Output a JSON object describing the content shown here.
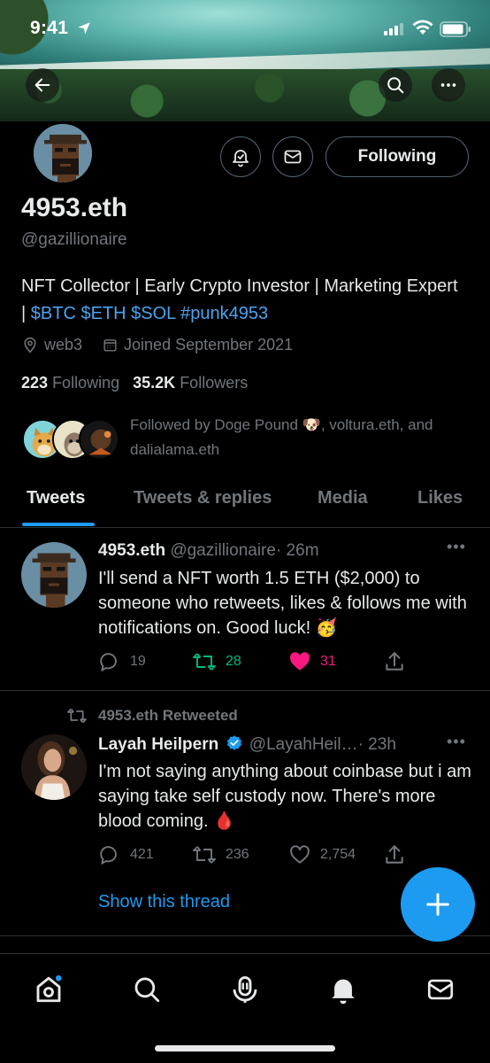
{
  "status_bar": {
    "time": "9:41"
  },
  "profile": {
    "name": "4953.eth",
    "handle": "@gazillionaire",
    "following_button": "Following",
    "bio_plain": "NFT Collector | Early Crypto Investor | Marketing Expert | ",
    "bio_links": [
      "$BTC",
      "$ETH",
      "$SOL",
      "#punk4953"
    ],
    "location": "web3",
    "joined": "Joined September 2021",
    "following_count": "223",
    "following_label": "Following",
    "followers_count": "35.2K",
    "followers_label": "Followers",
    "followed_by": "Followed by Doge Pound 🐶, voltura.eth, and dalialama.eth"
  },
  "tabs": [
    {
      "label": "Tweets",
      "active": true
    },
    {
      "label": "Tweets & replies",
      "active": false
    },
    {
      "label": "Media",
      "active": false
    },
    {
      "label": "Likes",
      "active": false
    }
  ],
  "tweets": [
    {
      "author": "4953.eth",
      "handle": "@gazillionaire",
      "time": "· 26m",
      "text": "I'll send a NFT worth 1.5 ETH ($2,000) to someone who retweets, likes & follows me with notifications on. Good luck! 🥳",
      "replies": "19",
      "retweets": "28",
      "likes": "31"
    },
    {
      "retweeted_by": "4953.eth Retweeted",
      "author": "Layah Heilpern",
      "handle": "@LayahHeil…",
      "time": "· 23h",
      "text": "I'm not saying anything about coinbase but i am saying take self custody now. There's more blood coming. 🩸",
      "replies": "421",
      "retweets": "236",
      "likes": "2,754",
      "thread_link": "Show this thread"
    }
  ],
  "colors": {
    "accent": "#1d9bf0",
    "retweet": "#00ba7c",
    "like": "#f91880"
  }
}
